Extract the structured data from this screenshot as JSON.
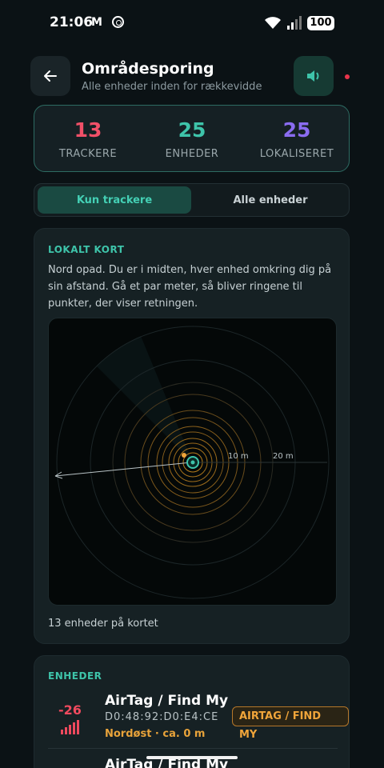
{
  "status": {
    "time": "21:06",
    "mail": "M",
    "battery": "100"
  },
  "header": {
    "title": "Områdesporing",
    "subtitle": "Alle enheder inden for rækkevidde"
  },
  "stats": [
    {
      "value": "13",
      "label": "TRACKERE",
      "color": "#f05068"
    },
    {
      "value": "25",
      "label": "ENHEDER",
      "color": "#3ec4aa"
    },
    {
      "value": "25",
      "label": "LOKALISERET",
      "color": "#8a6cf0"
    }
  ],
  "filter": {
    "active": "Kun trackere",
    "inactive": "Alle enheder"
  },
  "map": {
    "title": "LOKALT KORT",
    "description": "Nord opad. Du er i midten, hver enhed omkring dig på sin afstand. Gå et par meter, så bliver ringene til punkter, der viser retningen.",
    "ring_labels": [
      "10 m",
      "20 m"
    ],
    "count_text": "13 enheder på kortet"
  },
  "devices": {
    "title": "ENHEDER",
    "items": [
      {
        "rssi": "-26",
        "name": "AirTag / Find My",
        "mac": "D0:48:92:D0:E4:CE",
        "direction": "Nordøst · ca. 0 m",
        "badge": "AIRTAG / FIND MY"
      },
      {
        "name": "AirTag / Find My"
      }
    ]
  },
  "colors": {
    "accent": "#3ec4aa",
    "tracker": "#f05068",
    "warning": "#f0a53a",
    "located": "#8a6cf0"
  }
}
